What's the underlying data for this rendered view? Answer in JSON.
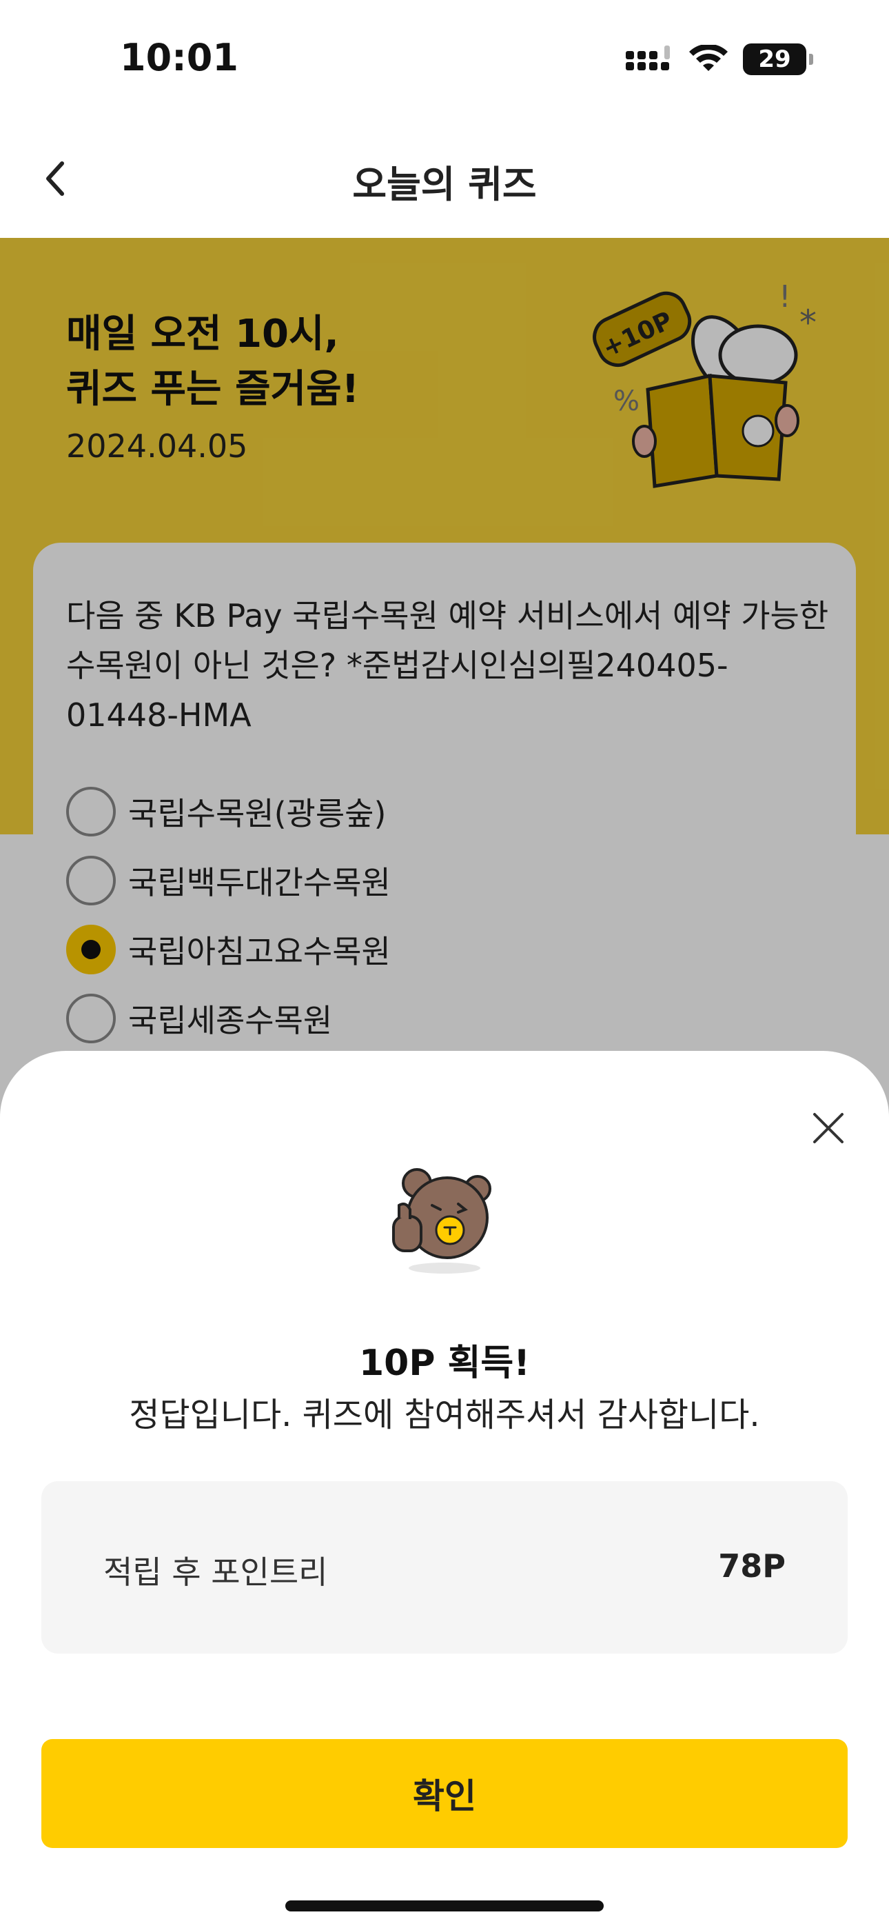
{
  "status_bar": {
    "time": "10:01",
    "battery": "29"
  },
  "header": {
    "title": "오늘의 퀴즈"
  },
  "hero": {
    "title": "매일 오전 10시,\n퀴즈 푸는 즐거움!",
    "date": "2024.04.05",
    "badge": "+10P"
  },
  "quiz": {
    "question": "다음 중 KB Pay 국립수목원 예약 서비스에서 예약 가능한 수목원이 아닌 것은? *준법감시인심의필240405-01448-HMA",
    "options": [
      {
        "label": "국립수목원(광릉숲)",
        "selected": false
      },
      {
        "label": "국립백두대간수목원",
        "selected": false
      },
      {
        "label": "국립아침고요수목원",
        "selected": true
      },
      {
        "label": "국립세종수목원",
        "selected": false
      }
    ]
  },
  "sheet": {
    "title": "10P 획득!",
    "message": "정답입니다. 퀴즈에 참여해주셔서 감사합니다.",
    "points_label": "적립 후 포인트리",
    "points_value": "78P",
    "confirm_label": "확인"
  },
  "colors": {
    "accent": "#ffcc00",
    "hero_bg": "#f5d23a",
    "dim_overlay": "rgba(0,0,0,0.28)"
  }
}
